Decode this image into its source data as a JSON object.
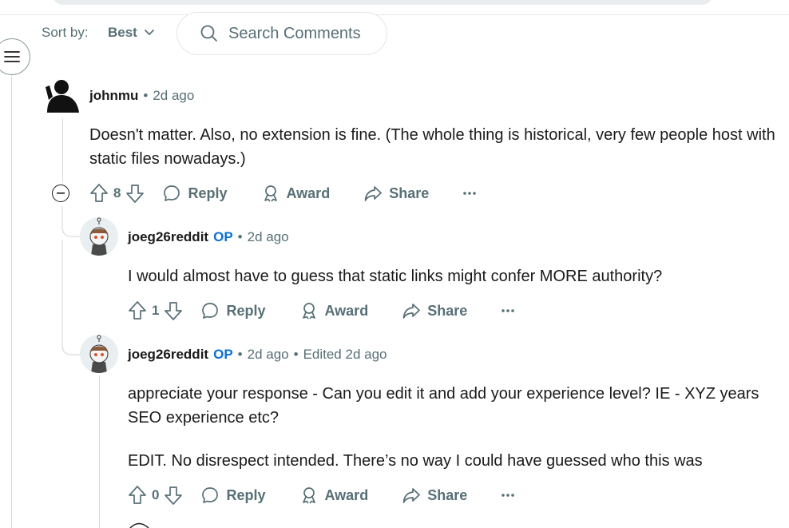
{
  "sort": {
    "label": "Sort by:",
    "value": "Best"
  },
  "search": {
    "placeholder": "Search Comments"
  },
  "comments": [
    {
      "user": "johnmu",
      "time": "2d ago",
      "body": "Doesn't matter. Also, no extension is fine. (The whole thing is historical, very few people host with static files nowadays.)",
      "score": "8",
      "actions": {
        "reply": "Reply",
        "award": "Award",
        "share": "Share"
      }
    },
    {
      "user": "joeg26reddit",
      "op": "OP",
      "time": "2d ago",
      "body": "I would almost have to guess that static links might confer MORE authority?",
      "score": "1",
      "actions": {
        "reply": "Reply",
        "award": "Award",
        "share": "Share"
      }
    },
    {
      "user": "joeg26reddit",
      "op": "OP",
      "time": "2d ago",
      "edited": "Edited 2d ago",
      "body": "appreciate your response - Can you edit it and add your experience level? IE - XYZ years SEO experience etc?",
      "body2": "EDIT. No disrespect intended. There’s no way I could have guessed who this was",
      "score": "0",
      "actions": {
        "reply": "Reply",
        "award": "Award",
        "share": "Share"
      }
    }
  ],
  "more_icon": "ellipsis-icon"
}
